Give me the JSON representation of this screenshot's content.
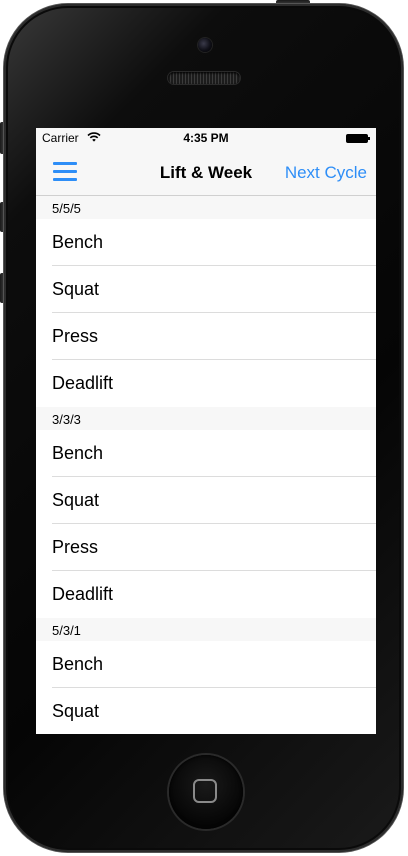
{
  "status_bar": {
    "carrier": "Carrier",
    "time": "4:35 PM"
  },
  "nav_bar": {
    "title": "Lift & Week",
    "menu_icon": "hamburger-menu-icon",
    "action_label": "Next Cycle"
  },
  "sections": [
    {
      "header": "5/5/5",
      "rows": [
        "Bench",
        "Squat",
        "Press",
        "Deadlift"
      ]
    },
    {
      "header": "3/3/3",
      "rows": [
        "Bench",
        "Squat",
        "Press",
        "Deadlift"
      ]
    },
    {
      "header": "5/3/1",
      "rows": [
        "Bench",
        "Squat"
      ]
    }
  ],
  "colors": {
    "accent": "#2e8ef7",
    "bar_background": "#f7f7f7",
    "separator": "#dcdcdc"
  }
}
